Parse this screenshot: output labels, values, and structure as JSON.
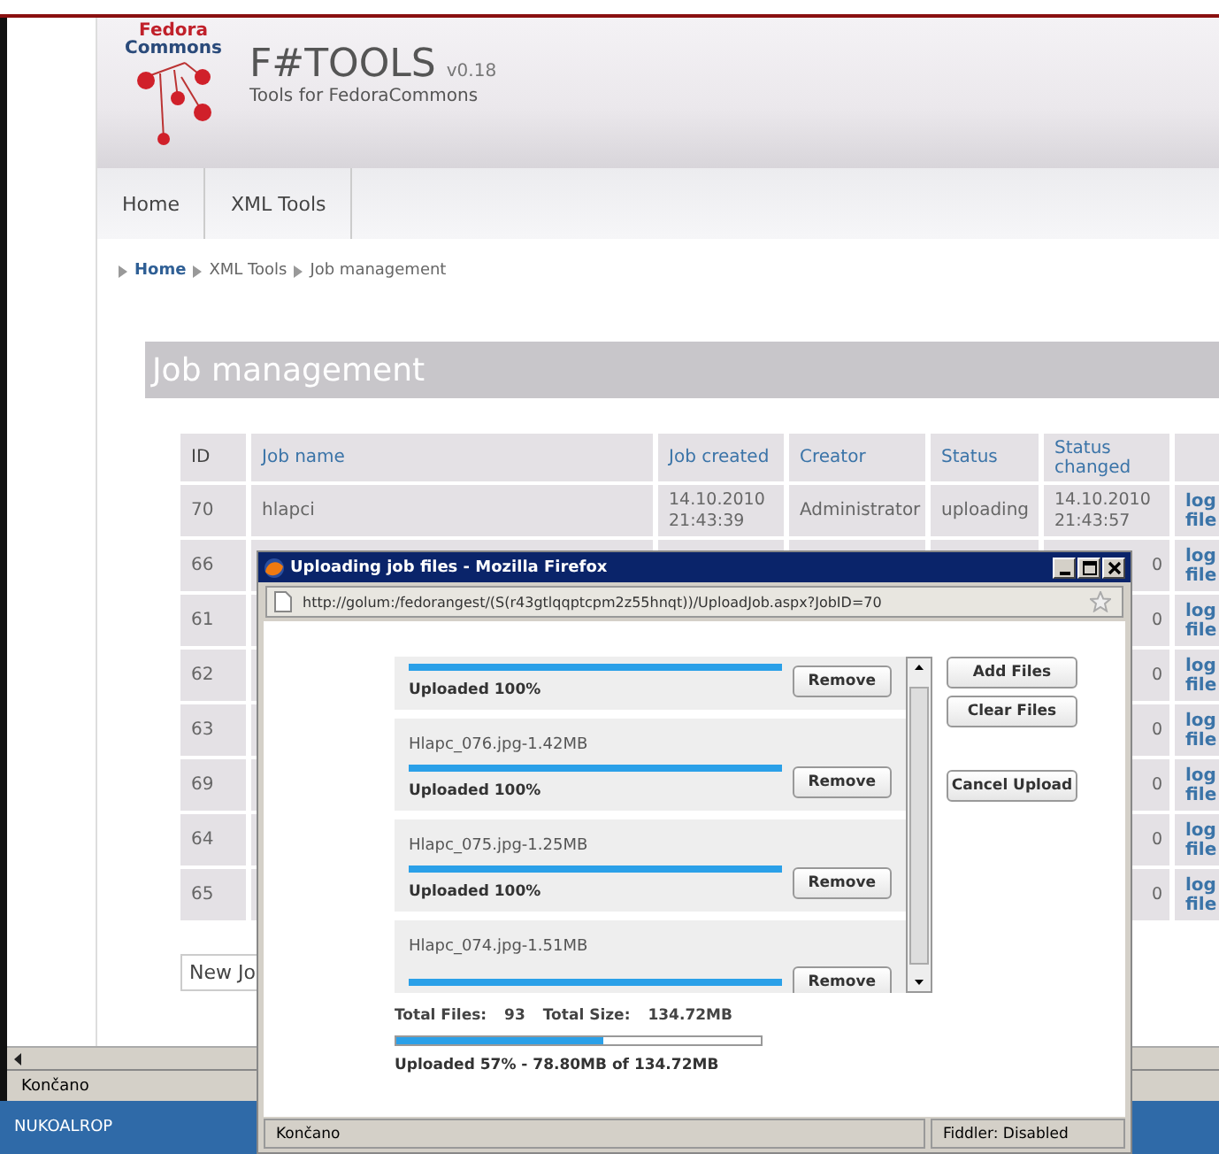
{
  "browser": {
    "status": "Končano"
  },
  "taskbar": {
    "item": "NUKOALROP"
  },
  "site": {
    "logo_top": "Fedora",
    "logo_bottom": "Commons",
    "title": "F#TOOLS",
    "version": "v0.18",
    "subtitle": "Tools for FedoraCommons"
  },
  "nav": [
    {
      "label": "Home"
    },
    {
      "label": "XML Tools"
    }
  ],
  "breadcrumb": [
    {
      "label": "Home",
      "link": true
    },
    {
      "label": "XML Tools",
      "link": false
    },
    {
      "label": "Job management",
      "link": false
    }
  ],
  "heading": "Job management",
  "table": {
    "columns": [
      "ID",
      "Job name",
      "Job created",
      "Creator",
      "Status",
      "Status changed"
    ],
    "rows": [
      {
        "id": "70",
        "job_name": "hlapci",
        "job_created": "14.10.2010 21:43:39",
        "creator": "Administrator",
        "status": "uploading",
        "status_changed": "14.10.2010 21:43:57",
        "log": "log file"
      },
      {
        "id": "66",
        "status_changed": "0",
        "log": "log file"
      },
      {
        "id": "61",
        "status_changed": "0",
        "log": "log file"
      },
      {
        "id": "62",
        "status_changed": "0",
        "log": "log file"
      },
      {
        "id": "63",
        "status_changed": "0",
        "log": "log file"
      },
      {
        "id": "69",
        "status_changed": "0",
        "log": "log file"
      },
      {
        "id": "64",
        "status_changed": "0",
        "log": "log file"
      },
      {
        "id": "65",
        "status_changed": "0",
        "log": "log file"
      }
    ]
  },
  "new_job_button": "New Jo",
  "popup": {
    "title": "Uploading job files - Mozilla Firefox",
    "url": "http://golum:/fedorangest/(S(r43gtlqqptcpm2z55hnqt))/UploadJob.aspx?JobID=70",
    "files": [
      {
        "level": 1,
        "status": "Uploaded 100%",
        "remove": "Remove"
      },
      {
        "name": "Hlapc_076.jpg-1.42MB",
        "level": 1,
        "status": "Uploaded 100%",
        "remove": "Remove"
      },
      {
        "name": "Hlapc_075.jpg-1.25MB",
        "level": 1,
        "status": "Uploaded 100%",
        "remove": "Remove"
      },
      {
        "name": "Hlapc_074.jpg-1.51MB",
        "level": 1,
        "remove": "Remove"
      }
    ],
    "actions": [
      "Add Files",
      "Clear Files",
      "Cancel Upload"
    ],
    "totals": {
      "files_label": "Total Files:",
      "files": "93",
      "size_label": "Total Size:",
      "size": "134.72MB"
    },
    "overall": {
      "level": 0.57,
      "text": "Uploaded 57% - 78.80MB of 134.72MB"
    },
    "status": "Končano",
    "addon": "Fiddler: Disabled"
  }
}
